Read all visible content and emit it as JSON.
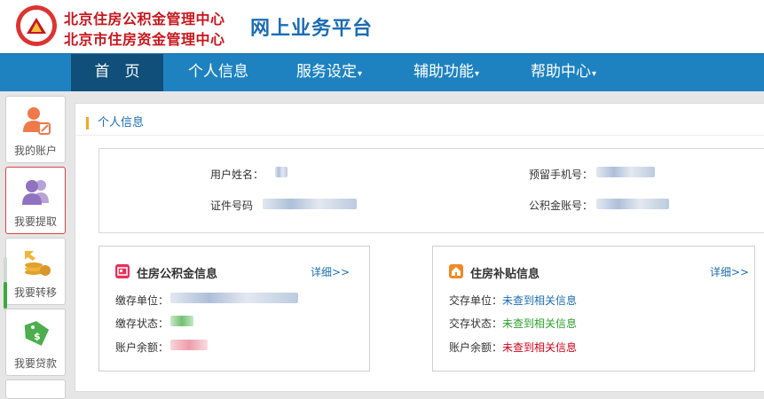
{
  "header": {
    "org_line1": "北京住房公积金管理中心",
    "org_line2": "北京市住房资金管理中心",
    "platform_title": "网上业务平台"
  },
  "nav": {
    "home": "首　页",
    "personal_info": "个人信息",
    "service_settings": "服务设定",
    "aux_functions": "辅助功能",
    "help_center": "帮助中心",
    "dropdown_caret": "▾"
  },
  "sidebar": {
    "items": [
      {
        "label": "我的账户",
        "icon": "user-edit-icon"
      },
      {
        "label": "我要提取",
        "icon": "users-icon"
      },
      {
        "label": "我要转移",
        "icon": "coins-transfer-icon"
      },
      {
        "label": "我要贷款",
        "icon": "money-tag-icon"
      }
    ]
  },
  "main": {
    "section_title": "个人信息",
    "personal": {
      "name_label": "用户姓名：",
      "id_label": "证件号码",
      "phone_label": "预留手机号：",
      "account_label": "公积金账号："
    },
    "fund_card": {
      "title": "住房公积金信息",
      "more": "详细>>",
      "unit_label": "缴存单位：",
      "status_label": "缴存状态：",
      "balance_label": "账户余额："
    },
    "subsidy_card": {
      "title": "住房补贴信息",
      "more": "详细>>",
      "unit_label": "交存单位：",
      "unit_value": "未查到相关信息",
      "status_label": "交存状态：",
      "status_value": "未查到相关信息",
      "balance_label": "账户余额：",
      "balance_value": "未查到相关信息"
    }
  },
  "colors": {
    "nav_bg": "#1f82c0",
    "nav_active": "#0f4f7a",
    "org_red": "#c8161d",
    "title_blue": "#1c6db3",
    "accent_orange": "#f5a623",
    "value_blue": "#1c6db3",
    "value_green": "#2ca02c",
    "value_red": "#d0021b"
  }
}
